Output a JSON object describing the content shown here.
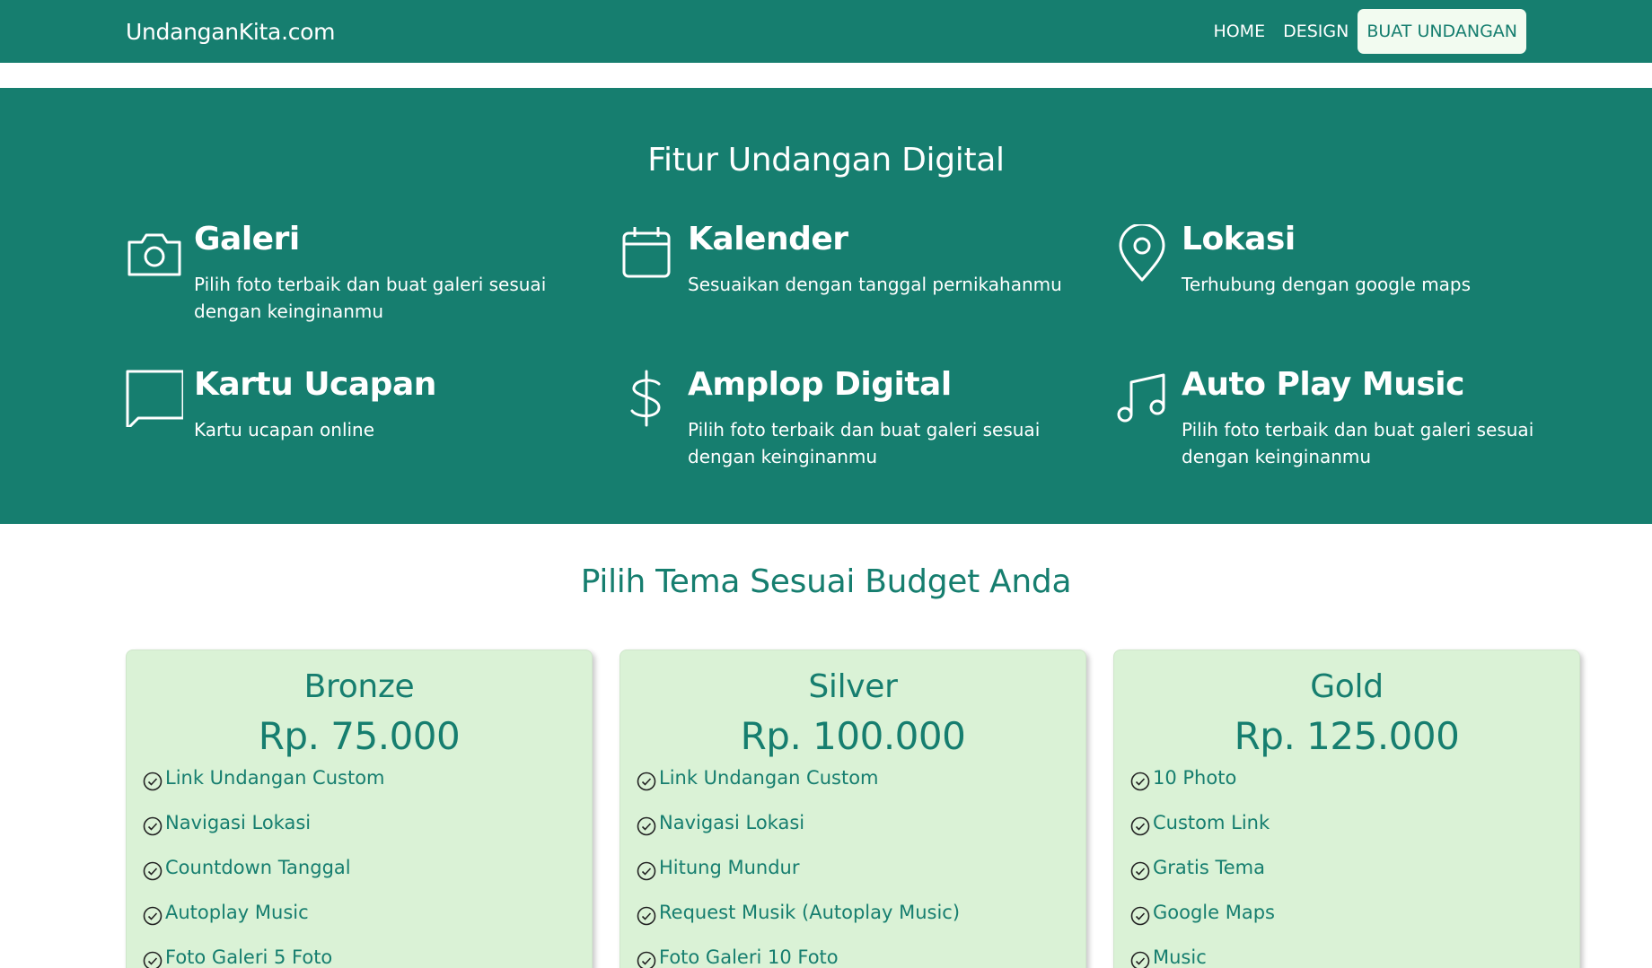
{
  "nav": {
    "brand": "UndanganKita.com",
    "links": [
      "HOME",
      "DESIGN"
    ],
    "cta": "BUAT UNDANGAN"
  },
  "features": {
    "title": "Fitur Undangan Digital",
    "items": [
      {
        "icon": "camera-icon",
        "title": "Galeri",
        "desc": "Pilih foto terbaik dan buat galeri sesuai dengan keinginanmu"
      },
      {
        "icon": "calendar-icon",
        "title": "Kalender",
        "desc": "Sesuaikan dengan tanggal pernikahanmu"
      },
      {
        "icon": "map-pin-icon",
        "title": "Lokasi",
        "desc": "Terhubung dengan google maps"
      },
      {
        "icon": "chat-bubble-icon",
        "title": "Kartu Ucapan",
        "desc": "Kartu ucapan online"
      },
      {
        "icon": "dollar-icon",
        "title": "Amplop Digital",
        "desc": "Pilih foto terbaik dan buat galeri sesuai dengan keinginanmu"
      },
      {
        "icon": "music-note-icon",
        "title": "Auto Play Music",
        "desc": "Pilih foto terbaik dan buat galeri sesuai dengan keinginanmu"
      }
    ]
  },
  "pricing": {
    "title": "Pilih Tema Sesuai Budget Anda",
    "plans": [
      {
        "name": "Bronze",
        "price": "Rp. 75.000",
        "items": [
          "Link Undangan Custom",
          "Navigasi Lokasi",
          "Countdown Tanggal",
          "Autoplay Music",
          "Foto Galeri 5 Foto"
        ]
      },
      {
        "name": "Silver",
        "price": "Rp. 100.000",
        "items": [
          "Link Undangan Custom",
          "Navigasi Lokasi",
          "Hitung Mundur",
          "Request Musik (Autoplay Music)",
          "Foto Galeri 10 Foto"
        ]
      },
      {
        "name": "Gold",
        "price": "Rp. 125.000",
        "items": [
          "10 Photo",
          "Custom Link",
          "Gratis Tema",
          "Google Maps",
          "Music"
        ]
      }
    ]
  },
  "colors": {
    "primary": "#167e6f",
    "card_bg": "#daf2d6",
    "cta_bg": "#f2fbf0"
  }
}
